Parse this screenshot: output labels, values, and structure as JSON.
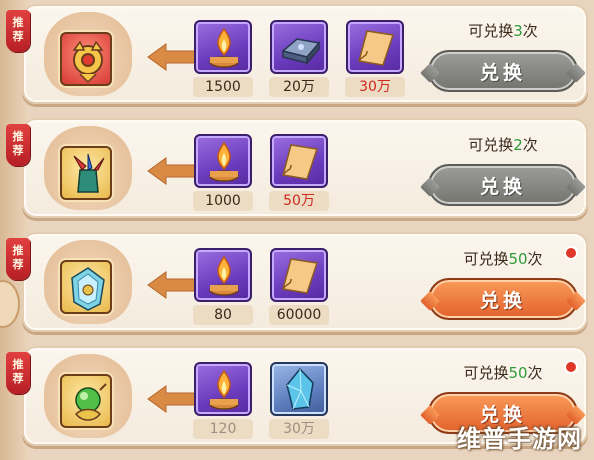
{
  "badge_text": [
    "推",
    "荐"
  ],
  "button_label": "兑换",
  "counter_prefix": "可兑换",
  "counter_suffix": "次",
  "watermark": "维普手游网",
  "colors": {
    "button_active": "#e2612c",
    "button_disabled": "#74746f",
    "count_green": "#2f9b3a",
    "qty_red": "#d0281e",
    "badge_red": "#c8282c"
  },
  "rows": [
    {
      "reward_icon": "red-mask-ornament-icon",
      "count": "3",
      "button_state": "disabled",
      "costs": [
        {
          "icon": "candle-flame-icon",
          "qty": "1500",
          "qty_color": "dark"
        },
        {
          "icon": "iron-ingot-icon",
          "qty": "20万",
          "qty_color": "dark"
        },
        {
          "icon": "paper-scroll-icon",
          "qty": "30万",
          "qty_color": "red"
        }
      ]
    },
    {
      "reward_icon": "feather-bundle-icon",
      "count": "2",
      "button_state": "disabled",
      "costs": [
        {
          "icon": "candle-flame-icon",
          "qty": "1000",
          "qty_color": "dark"
        },
        {
          "icon": "paper-scroll-icon",
          "qty": "50万",
          "qty_color": "red"
        }
      ]
    },
    {
      "reward_icon": "crystal-mirror-icon",
      "count": "50",
      "button_state": "active",
      "costs": [
        {
          "icon": "candle-flame-icon",
          "qty": "80",
          "qty_color": "dark"
        },
        {
          "icon": "paper-scroll-icon",
          "qty": "60000",
          "qty_color": "dark"
        }
      ]
    },
    {
      "reward_icon": "green-orb-ornament-icon",
      "count": "50",
      "button_state": "active",
      "costs": [
        {
          "icon": "candle-flame-icon",
          "qty": "120",
          "qty_color": "grey"
        },
        {
          "icon": "blue-crystal-icon",
          "qty": "30万",
          "qty_color": "grey"
        }
      ]
    }
  ]
}
